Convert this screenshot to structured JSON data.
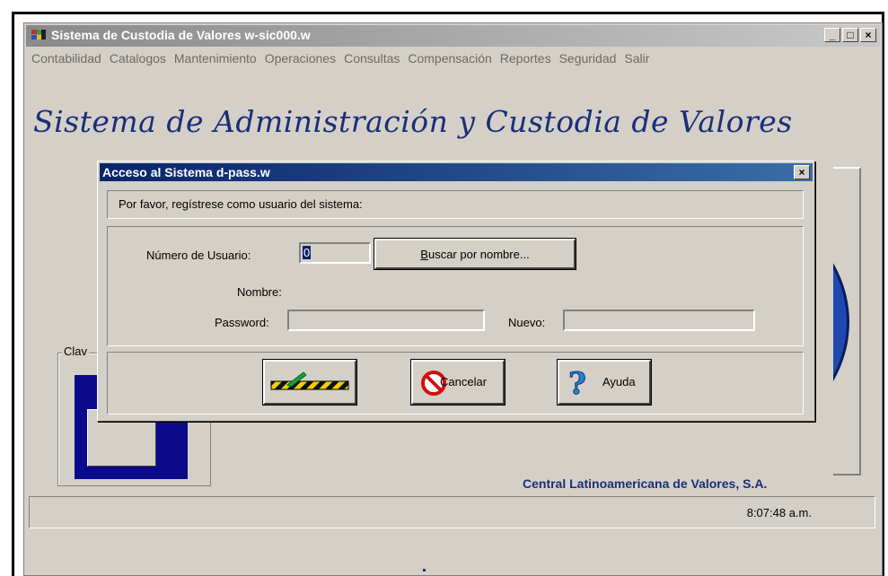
{
  "window": {
    "title": "Sistema de Custodia de Valores w-sic000.w",
    "controls": [
      "_",
      "□",
      "×"
    ]
  },
  "menu": [
    "Contabilidad",
    "Catalogos",
    "Mantenimiento",
    "Operaciones",
    "Consultas",
    "Compensación",
    "Reportes",
    "Seguridad",
    "Salir"
  ],
  "header": {
    "heading": "Sistema de Administración y Custodia de Valores"
  },
  "background": {
    "clave_label": "Clav",
    "company": "Central Latinoamericana de Valores, S.A.",
    "time": "8:07:48 a.m."
  },
  "dialog": {
    "title": "Acceso al Sistema d-pass.w",
    "close": "×",
    "prompt": "Por favor, regístrese como usuario del sistema:",
    "user_number_label": "Número de Usuario:",
    "user_number_value": "0",
    "search_button": "Buscar por nombre...",
    "search_hotkey": "B",
    "search_rest": "uscar por nombre...",
    "name_label": "Nombre:",
    "password_label": "Password:",
    "password_value": "",
    "new_label": "Nuevo:",
    "new_value": "",
    "cancel_button": "Cancelar",
    "help_button": "Ayuda"
  },
  "colors": {
    "title_blue": "#0a246a",
    "heading_blue": "#1a2e7a",
    "face": "#d4d0c8"
  }
}
